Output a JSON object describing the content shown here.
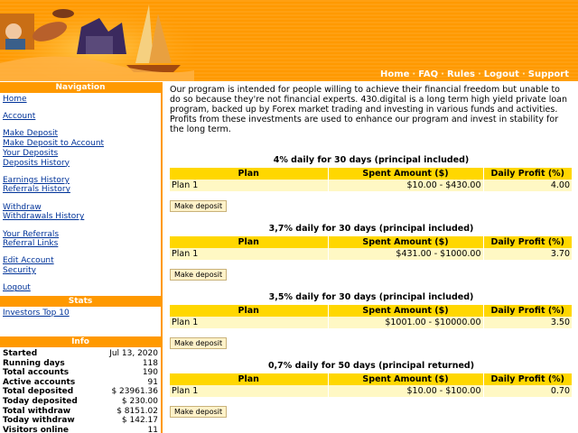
{
  "header": {
    "nav": [
      "Home",
      "FAQ",
      "Rules",
      "Logout",
      "Support"
    ],
    "colors": {
      "primary": "#ff9900",
      "table_head": "#ffd700",
      "table_row": "#fff8c4"
    }
  },
  "sidebar": {
    "nav_title": "Navigation",
    "nav_groups": [
      [
        "Home"
      ],
      [
        "Account"
      ],
      [
        "Make Deposit",
        "Make Deposit to Account",
        "Your Deposits",
        "Deposits History"
      ],
      [
        "Earnings History",
        "Referrals History"
      ],
      [
        "Withdraw",
        "Withdrawals History"
      ],
      [
        "Your Referrals",
        "Referral Links"
      ],
      [
        "Edit Account",
        "Security"
      ],
      [
        "Logout"
      ]
    ],
    "stats_title": "Stats",
    "stats_link": "Investors Top 10",
    "info_title": "Info",
    "info_rows": [
      {
        "label": "Started",
        "value": "Jul 13, 2020"
      },
      {
        "label": "Running days",
        "value": "118"
      },
      {
        "label": "Total accounts",
        "value": "190"
      },
      {
        "label": "Active accounts",
        "value": "91"
      },
      {
        "label": "Total deposited",
        "value": "$ 23961.36"
      },
      {
        "label": "Today deposited",
        "value": "$ 230.00"
      },
      {
        "label": "Total withdraw",
        "value": "$ 8151.02"
      },
      {
        "label": "Today withdraw",
        "value": "$ 142.17"
      },
      {
        "label": "Visitors online",
        "value": "11"
      }
    ]
  },
  "main": {
    "intro": "Our program is intended for people willing to achieve their financial freedom but unable to do so because they're not financial experts. 430.digital is a long term high yield private loan program, backed up by Forex market trading and investing in various funds and activities. Profits from these investments are used to enhance our program and invest in stability for the long term.",
    "columns": [
      "Plan",
      "Spent Amount ($)",
      "Daily Profit (%)"
    ],
    "button_label": "Make deposit",
    "plans": [
      {
        "title": "4% daily for 30 days (principal included)",
        "name": "Plan 1",
        "amount": "$10.00 - $430.00",
        "profit": "4.00"
      },
      {
        "title": "3,7% daily for 30 days (principal included)",
        "name": "Plan 1",
        "amount": "$431.00 - $1000.00",
        "profit": "3.70"
      },
      {
        "title": "3,5% daily for 30 days (principal included)",
        "name": "Plan 1",
        "amount": "$1001.00 - $10000.00",
        "profit": "3.50"
      },
      {
        "title": "0,7% daily for 50 days (principal returned)",
        "name": "Plan 1",
        "amount": "$10.00 - $100.00",
        "profit": "0.70"
      }
    ]
  }
}
